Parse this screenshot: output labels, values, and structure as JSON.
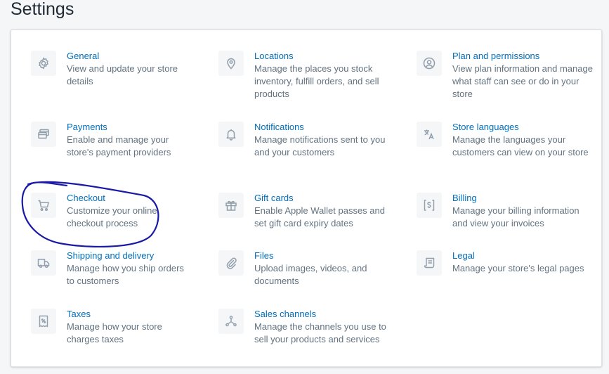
{
  "page": {
    "title": "Settings"
  },
  "settings": {
    "general": {
      "title": "General",
      "desc": "View and update your store details",
      "icon": "gear-icon"
    },
    "locations": {
      "title": "Locations",
      "desc": "Manage the places you stock inventory, fulfill orders, and sell products",
      "icon": "location-pin-icon"
    },
    "plan": {
      "title": "Plan and permissions",
      "desc": "View plan information and manage what staff can see or do in your store",
      "icon": "user-circle-icon"
    },
    "payments": {
      "title": "Payments",
      "desc": "Enable and manage your store's payment providers",
      "icon": "credit-card-icon"
    },
    "notifications": {
      "title": "Notifications",
      "desc": "Manage notifications sent to you and your customers",
      "icon": "bell-icon"
    },
    "store_languages": {
      "title": "Store languages",
      "desc": "Manage the languages your customers can view on your store",
      "icon": "translate-icon"
    },
    "checkout": {
      "title": "Checkout",
      "desc": "Customize your online checkout process",
      "icon": "cart-icon"
    },
    "gift_cards": {
      "title": "Gift cards",
      "desc": "Enable Apple Wallet passes and set gift card expiry dates",
      "icon": "gift-icon"
    },
    "billing": {
      "title": "Billing",
      "desc": "Manage your billing information and view your invoices",
      "icon": "billing-icon"
    },
    "shipping": {
      "title": "Shipping and delivery",
      "desc": "Manage how you ship orders to customers",
      "icon": "truck-icon"
    },
    "files": {
      "title": "Files",
      "desc": "Upload images, videos, and documents",
      "icon": "paperclip-icon"
    },
    "legal": {
      "title": "Legal",
      "desc": "Manage your store's legal pages",
      "icon": "document-icon"
    },
    "taxes": {
      "title": "Taxes",
      "desc": "Manage how your store charges taxes",
      "icon": "receipt-icon"
    },
    "sales_channels": {
      "title": "Sales channels",
      "desc": "Manage the channels you use to sell your products and services",
      "icon": "channels-icon"
    }
  },
  "colors": {
    "link": "#006fbb",
    "description": "#637381",
    "icon": "#919eab",
    "annotation": "#1a1aa6"
  }
}
